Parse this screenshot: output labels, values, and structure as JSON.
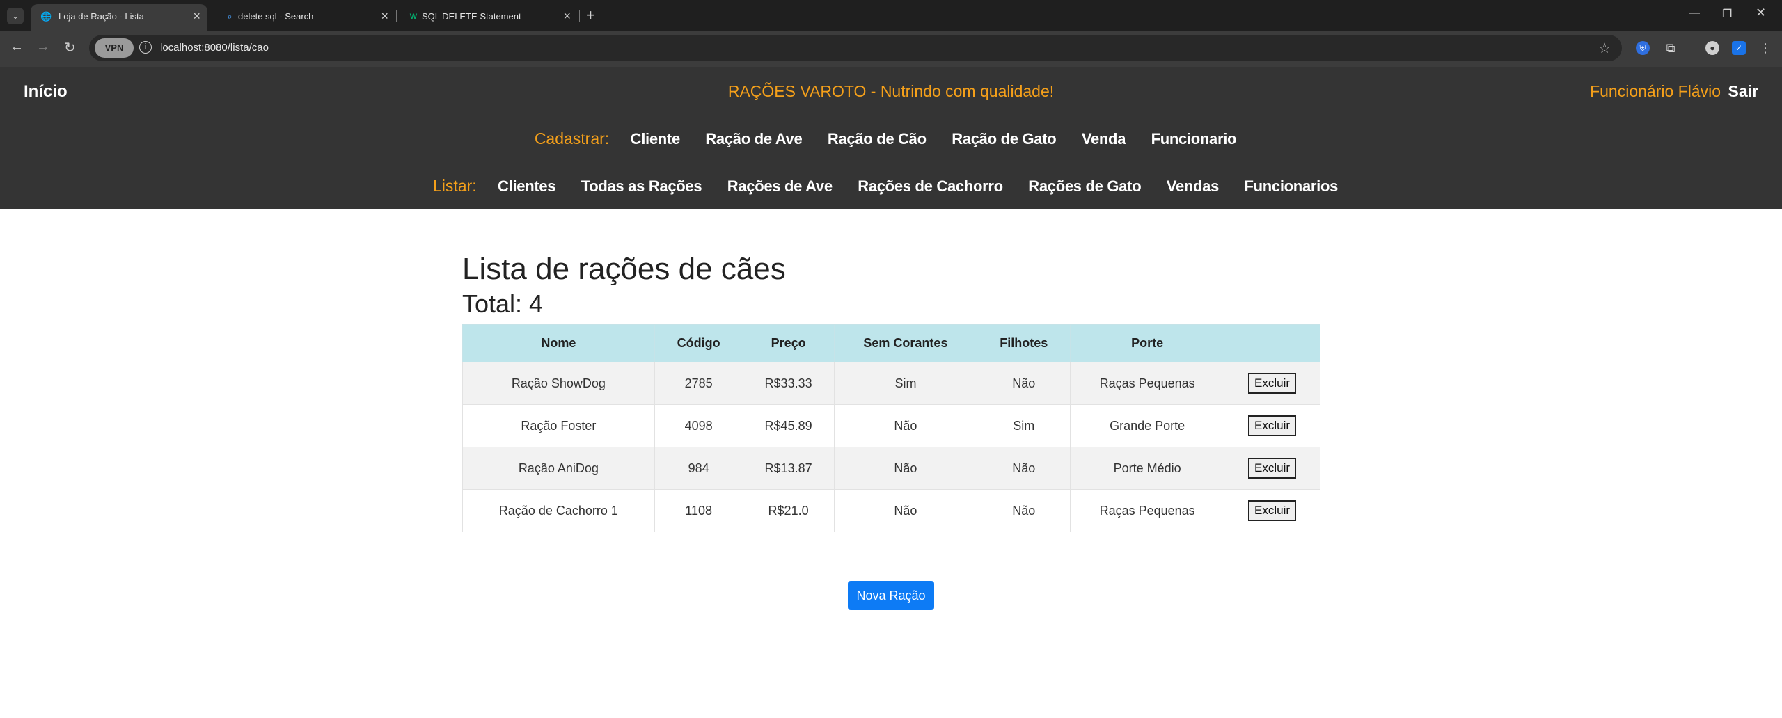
{
  "browser": {
    "tabs": [
      {
        "title": "Loja de Ração - Lista",
        "active": true
      },
      {
        "title": "delete sql - Search",
        "active": false
      },
      {
        "title": "SQL DELETE Statement",
        "active": false
      }
    ],
    "url": "localhost:8080/lista/cao",
    "vpn_label": "VPN"
  },
  "header": {
    "home": "Início",
    "slogan": "RAÇÕES VAROTO - Nutrindo com qualidade!",
    "employee": "Funcionário Flávio",
    "logout": "Sair",
    "register_label": "Cadastrar:",
    "register_links": [
      "Cliente",
      "Ração de Ave",
      "Ração de Cão",
      "Ração de Gato",
      "Venda",
      "Funcionario"
    ],
    "list_label": "Listar:",
    "list_links": [
      "Clientes",
      "Todas as Rações",
      "Rações de Ave",
      "Rações de Cachorro",
      "Rações de Gato",
      "Vendas",
      "Funcionarios"
    ]
  },
  "main": {
    "title": "Lista de rações de cães",
    "total_label": "Total:",
    "total_value": "4",
    "columns": [
      "Nome",
      "Código",
      "Preço",
      "Sem Corantes",
      "Filhotes",
      "Porte",
      ""
    ],
    "rows": [
      {
        "nome": "Ração ShowDog",
        "codigo": "2785",
        "preco": "R$33.33",
        "sem_corantes": "Sim",
        "filhotes": "Não",
        "porte": "Raças Pequenas"
      },
      {
        "nome": "Ração Foster",
        "codigo": "4098",
        "preco": "R$45.89",
        "sem_corantes": "Não",
        "filhotes": "Sim",
        "porte": "Grande Porte"
      },
      {
        "nome": "Ração AniDog",
        "codigo": "984",
        "preco": "R$13.87",
        "sem_corantes": "Não",
        "filhotes": "Não",
        "porte": "Porte Médio"
      },
      {
        "nome": "Ração de Cachorro 1",
        "codigo": "1108",
        "preco": "R$21.0",
        "sem_corantes": "Não",
        "filhotes": "Não",
        "porte": "Raças Pequenas"
      }
    ],
    "delete_label": "Excluir",
    "new_button": "Nova Ração"
  },
  "colors": {
    "accent": "#f5a01a",
    "header_bg": "#343434",
    "table_head": "#bee5eb",
    "primary_button": "#0d7bf5"
  }
}
